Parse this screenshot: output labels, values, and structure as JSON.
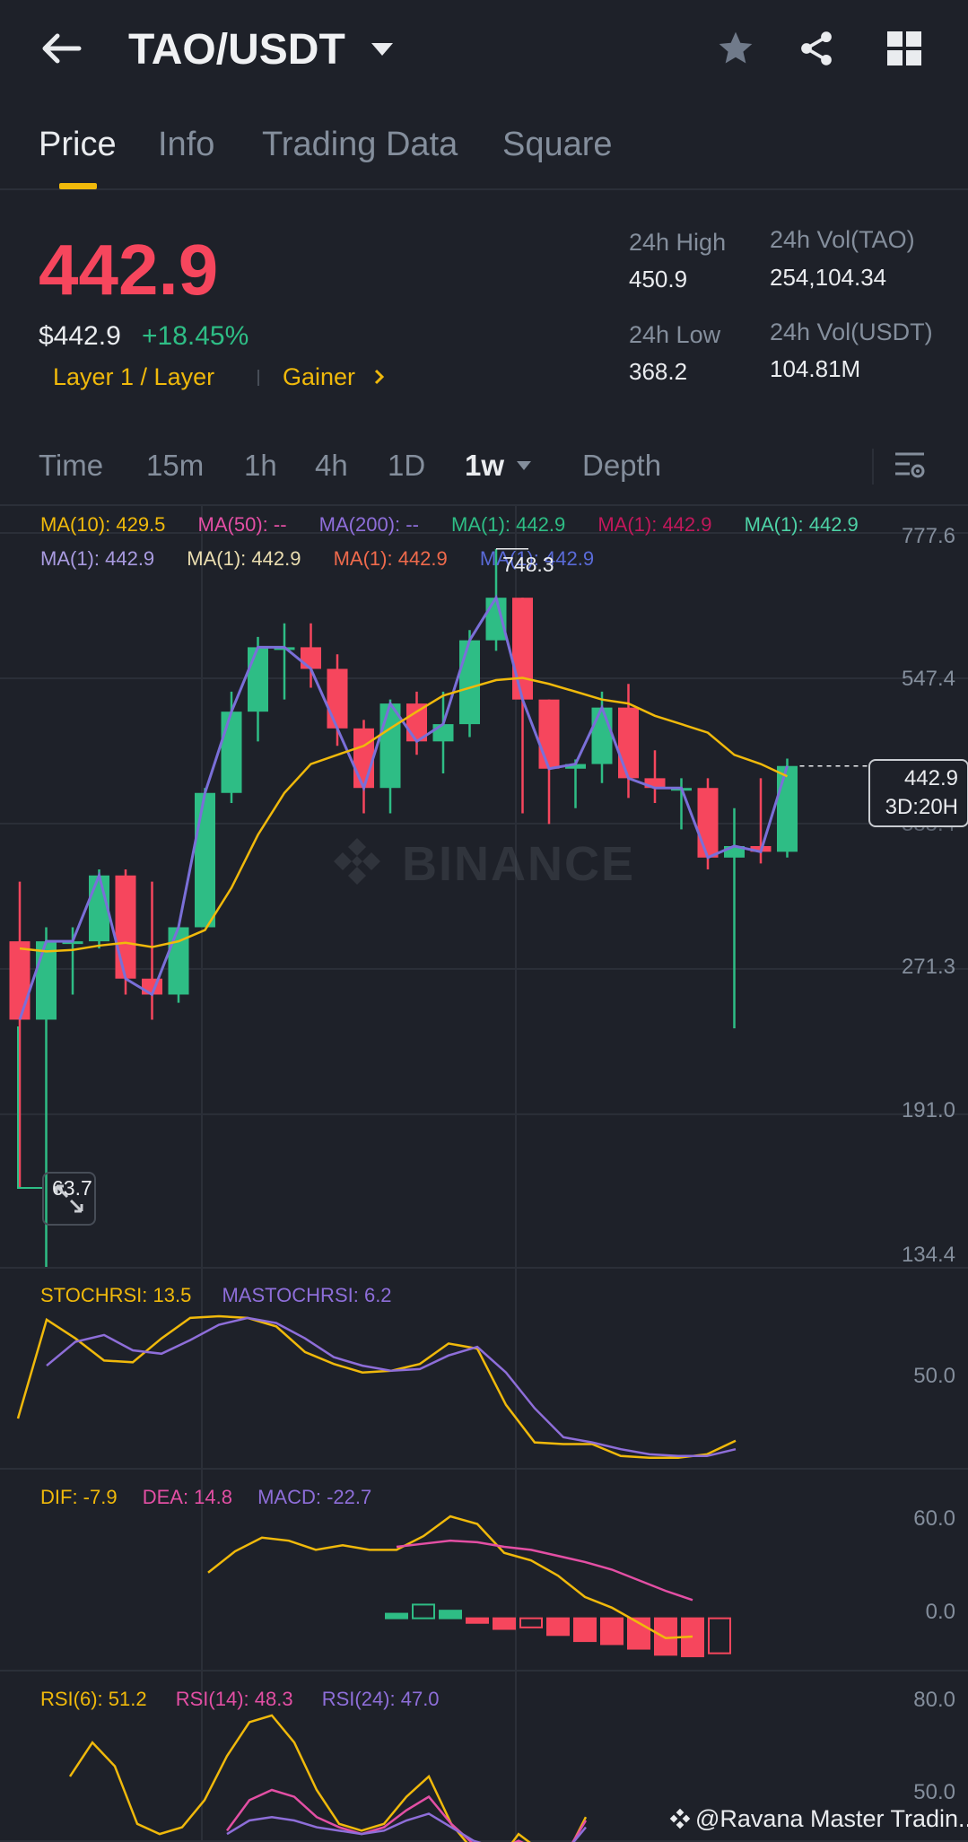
{
  "header": {
    "pair": "TAO/USDT"
  },
  "tabs": [
    {
      "label": "Price",
      "active": true
    },
    {
      "label": "Info",
      "active": false
    },
    {
      "label": "Trading Data",
      "active": false
    },
    {
      "label": "Square",
      "active": false
    }
  ],
  "ticker": {
    "last_price": "442.9",
    "usd_price": "$442.9",
    "change": "+18.45%",
    "tag_category": "Layer 1 / Layer",
    "tag_gainer": "Gainer",
    "high_label": "24h High",
    "high": "450.9",
    "low_label": "24h Low",
    "low": "368.2",
    "vol_base_label": "24h Vol(TAO)",
    "vol_base": "254,104.34",
    "vol_quote_label": "24h Vol(USDT)",
    "vol_quote": "104.81M"
  },
  "intervals": {
    "time": "Time",
    "m15": "15m",
    "h1": "1h",
    "h4": "4h",
    "d1": "1D",
    "w1": "1w",
    "depth": "Depth"
  },
  "ma_legend": {
    "row1": [
      "MA(10): 429.5",
      "MA(50): --",
      "MA(200): --",
      "MA(1): 442.9",
      "MA(1): 442.9",
      "MA(1): 442.9"
    ],
    "row2": [
      "MA(1): 442.9",
      "MA(1): 442.9",
      "MA(1): 442.9",
      "MA(1): 442.9"
    ]
  },
  "price_axis": [
    "777.6",
    "547.4",
    "385.4",
    "271.3",
    "191.0",
    "134.4"
  ],
  "markers": {
    "high": "748.3",
    "low": "63.7",
    "current_price": "442.9",
    "countdown": "3D:20H"
  },
  "watermark_brand": "BINANCE",
  "stoch": {
    "stoch_label": "STOCHRSI: 13.5",
    "ma_label": "MASTOCHRSI: 6.2",
    "axis": "50.0"
  },
  "macd": {
    "dif": "DIF: -7.9",
    "dea": "DEA: 14.8",
    "macd": "MACD: -22.7",
    "axis_top": "60.0",
    "axis_mid": "0.0"
  },
  "rsi": {
    "rsi6": "RSI(6): 51.2",
    "rsi14": "RSI(14): 48.3",
    "rsi24": "RSI(24): 47.0",
    "axis_top": "80.0",
    "axis_mid": "50.0"
  },
  "footer": {
    "credit": "@Ravana Master Tradin..."
  },
  "colors": {
    "up": "#2ebd85",
    "down": "#f6465d",
    "accent": "#f0b90b",
    "purple": "#8e6ed9",
    "pink": "#e34fa4",
    "bg": "#1e2129"
  },
  "chart_data": {
    "type": "candlestick",
    "y_range": [
      134.4,
      777.6
    ],
    "y_scale": "log",
    "candles": [
      {
        "o": 290,
        "h": 335,
        "l": 160,
        "c": 240
      },
      {
        "o": 240,
        "h": 300,
        "l": 105,
        "c": 290
      },
      {
        "o": 290,
        "h": 300,
        "l": 255,
        "c": 290
      },
      {
        "o": 290,
        "h": 345,
        "l": 285,
        "c": 340
      },
      {
        "o": 340,
        "h": 345,
        "l": 255,
        "c": 265
      },
      {
        "o": 265,
        "h": 335,
        "l": 240,
        "c": 255
      },
      {
        "o": 255,
        "h": 300,
        "l": 250,
        "c": 300
      },
      {
        "o": 300,
        "h": 420,
        "l": 300,
        "c": 415
      },
      {
        "o": 415,
        "h": 530,
        "l": 405,
        "c": 505
      },
      {
        "o": 505,
        "h": 605,
        "l": 470,
        "c": 590
      },
      {
        "o": 590,
        "h": 625,
        "l": 520,
        "c": 590
      },
      {
        "o": 590,
        "h": 625,
        "l": 535,
        "c": 560
      },
      {
        "o": 560,
        "h": 580,
        "l": 465,
        "c": 485
      },
      {
        "o": 485,
        "h": 495,
        "l": 395,
        "c": 420
      },
      {
        "o": 420,
        "h": 520,
        "l": 395,
        "c": 515
      },
      {
        "o": 515,
        "h": 530,
        "l": 455,
        "c": 470
      },
      {
        "o": 470,
        "h": 530,
        "l": 435,
        "c": 490
      },
      {
        "o": 490,
        "h": 615,
        "l": 475,
        "c": 600
      },
      {
        "o": 600,
        "h": 748.3,
        "l": 585,
        "c": 665
      },
      {
        "o": 665,
        "h": 665,
        "l": 395,
        "c": 520
      },
      {
        "o": 520,
        "h": 520,
        "l": 385,
        "c": 440
      },
      {
        "o": 440,
        "h": 450,
        "l": 400,
        "c": 445
      },
      {
        "o": 445,
        "h": 530,
        "l": 425,
        "c": 510
      },
      {
        "o": 510,
        "h": 540,
        "l": 410,
        "c": 430
      },
      {
        "o": 430,
        "h": 460,
        "l": 405,
        "c": 420
      },
      {
        "o": 420,
        "h": 430,
        "l": 380,
        "c": 420
      },
      {
        "o": 420,
        "h": 430,
        "l": 345,
        "c": 355
      },
      {
        "o": 355,
        "h": 400,
        "l": 235,
        "c": 365
      },
      {
        "o": 365,
        "h": 430,
        "l": 350,
        "c": 360
      },
      {
        "o": 360,
        "h": 450.9,
        "l": 355,
        "c": 442.9
      }
    ],
    "ma10": [
      285,
      283,
      284,
      287,
      289,
      286,
      290,
      298,
      330,
      375,
      415,
      445,
      455,
      465,
      485,
      505,
      525,
      535,
      545,
      548,
      540,
      530,
      520,
      515,
      500,
      490,
      480,
      455,
      445,
      432
    ],
    "stochrsi": [
      30,
      88,
      77,
      64,
      63,
      77,
      89,
      90,
      89,
      84,
      69,
      62,
      57,
      58,
      62,
      74,
      71,
      38,
      16,
      15,
      15,
      8,
      7,
      7,
      9,
      17
    ],
    "mastochrsi": [
      null,
      61,
      75,
      79,
      70,
      68,
      76,
      85,
      89,
      86,
      77,
      66,
      61,
      58,
      59,
      67,
      72,
      57,
      36,
      19,
      16,
      12,
      9,
      8,
      8,
      12
    ],
    "macd_hist": [
      null,
      null,
      null,
      null,
      null,
      null,
      null,
      null,
      null,
      null,
      null,
      null,
      null,
      null,
      null,
      3,
      9,
      5,
      -3,
      -7,
      -6,
      -11,
      -15,
      -17,
      -20,
      -24,
      -25,
      -23
    ],
    "dif": [
      null,
      null,
      null,
      null,
      null,
      null,
      null,
      null,
      30,
      44,
      53,
      51,
      45,
      48,
      45,
      45,
      54,
      67,
      62,
      43,
      38,
      28,
      14,
      7,
      -3,
      -13,
      -12
    ],
    "dea": [
      null,
      null,
      null,
      null,
      null,
      null,
      null,
      null,
      null,
      null,
      null,
      null,
      null,
      null,
      null,
      47,
      49,
      51,
      50,
      47,
      45,
      41,
      37,
      32,
      25,
      18,
      12
    ],
    "rsi6": [
      62,
      72,
      65,
      48,
      45,
      47,
      55,
      68,
      78,
      80,
      72,
      58,
      48,
      46,
      48,
      56,
      62,
      48,
      40,
      36,
      45,
      40,
      37,
      50
    ],
    "rsi14": [
      null,
      null,
      null,
      null,
      null,
      null,
      null,
      46,
      55,
      58,
      56,
      50,
      47,
      45,
      47,
      52,
      56,
      48,
      42,
      40,
      43,
      40,
      38,
      49
    ],
    "rsi24": [
      null,
      null,
      null,
      null,
      null,
      null,
      null,
      45,
      49,
      50,
      49,
      47,
      46,
      45,
      46,
      49,
      51,
      47,
      43,
      41,
      42,
      40,
      39,
      47
    ]
  }
}
